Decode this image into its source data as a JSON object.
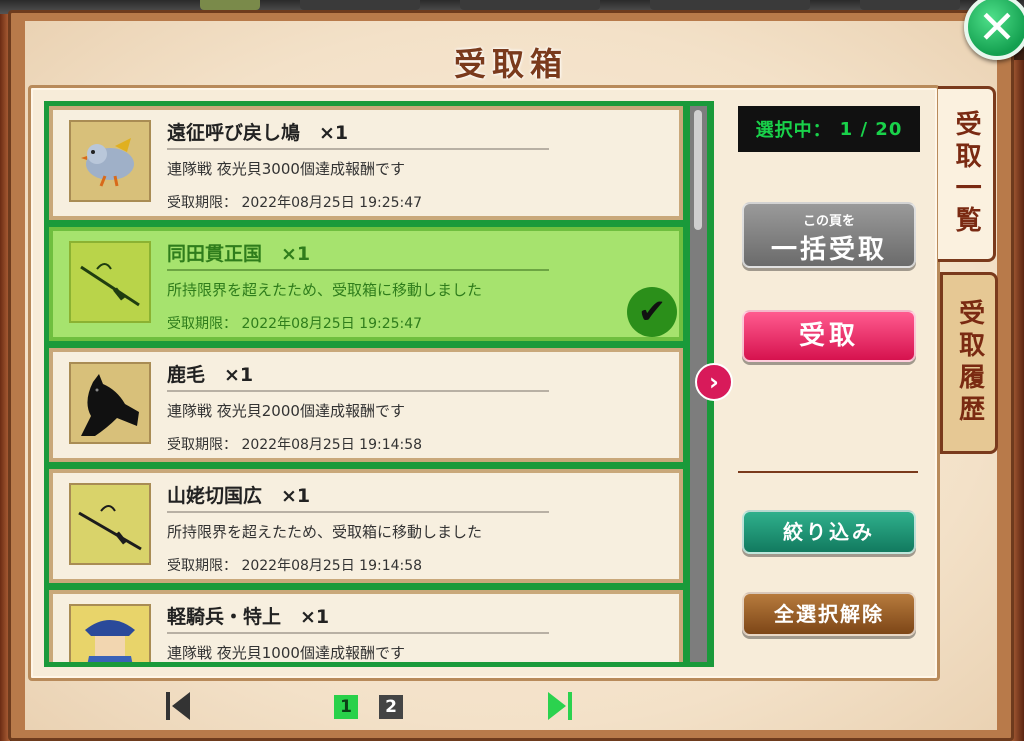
{
  "dialog": {
    "title": "受取箱",
    "close_icon": "close-icon"
  },
  "counter": {
    "label": "選択中：",
    "value": "1 / 20"
  },
  "buttons": {
    "bulk_small": "この頁を",
    "bulk_big": "一括受取",
    "receive": "受取",
    "filter": "絞り込み",
    "deselect_all": "全選択解除"
  },
  "tabs": {
    "receive_list": "受取一覧",
    "receive_history": "受取履歴"
  },
  "items": [
    {
      "name": "遠征呼び戻し鳩　×1",
      "desc": "連隊戦 夜光貝3000個達成報酬です",
      "expiry": "受取期限：  2022年08月25日 19:25:47",
      "icon": "pigeon-icon",
      "selected": false
    },
    {
      "name": "同田貫正国　×1",
      "desc": "所持限界を超えたため、受取箱に移動しました",
      "expiry": "受取期限：  2022年08月25日 19:25:47",
      "icon": "sword-icon",
      "selected": true
    },
    {
      "name": "鹿毛　×1",
      "desc": "連隊戦 夜光貝2000個達成報酬です",
      "expiry": "受取期限：  2022年08月25日 19:14:58",
      "icon": "horse-icon",
      "selected": false
    },
    {
      "name": "山姥切国広　×1",
      "desc": "所持限界を超えたため、受取箱に移動しました",
      "expiry": "受取期限：  2022年08月25日 19:14:58",
      "icon": "sword-icon",
      "selected": false
    },
    {
      "name": "軽騎兵・特上　×1",
      "desc": "連隊戦 夜光貝1000個達成報酬です",
      "expiry": "",
      "icon": "cavalry-soldier-icon",
      "selected": false
    }
  ],
  "pagination": {
    "pages": [
      "1",
      "2"
    ],
    "current": "1"
  },
  "colors": {
    "selection_green": "#1a9a3a",
    "selected_item": "#a6e36e",
    "receive_pink": "#d6124e",
    "filter_teal": "#127a5f",
    "deselect_brown": "#7d4617"
  }
}
